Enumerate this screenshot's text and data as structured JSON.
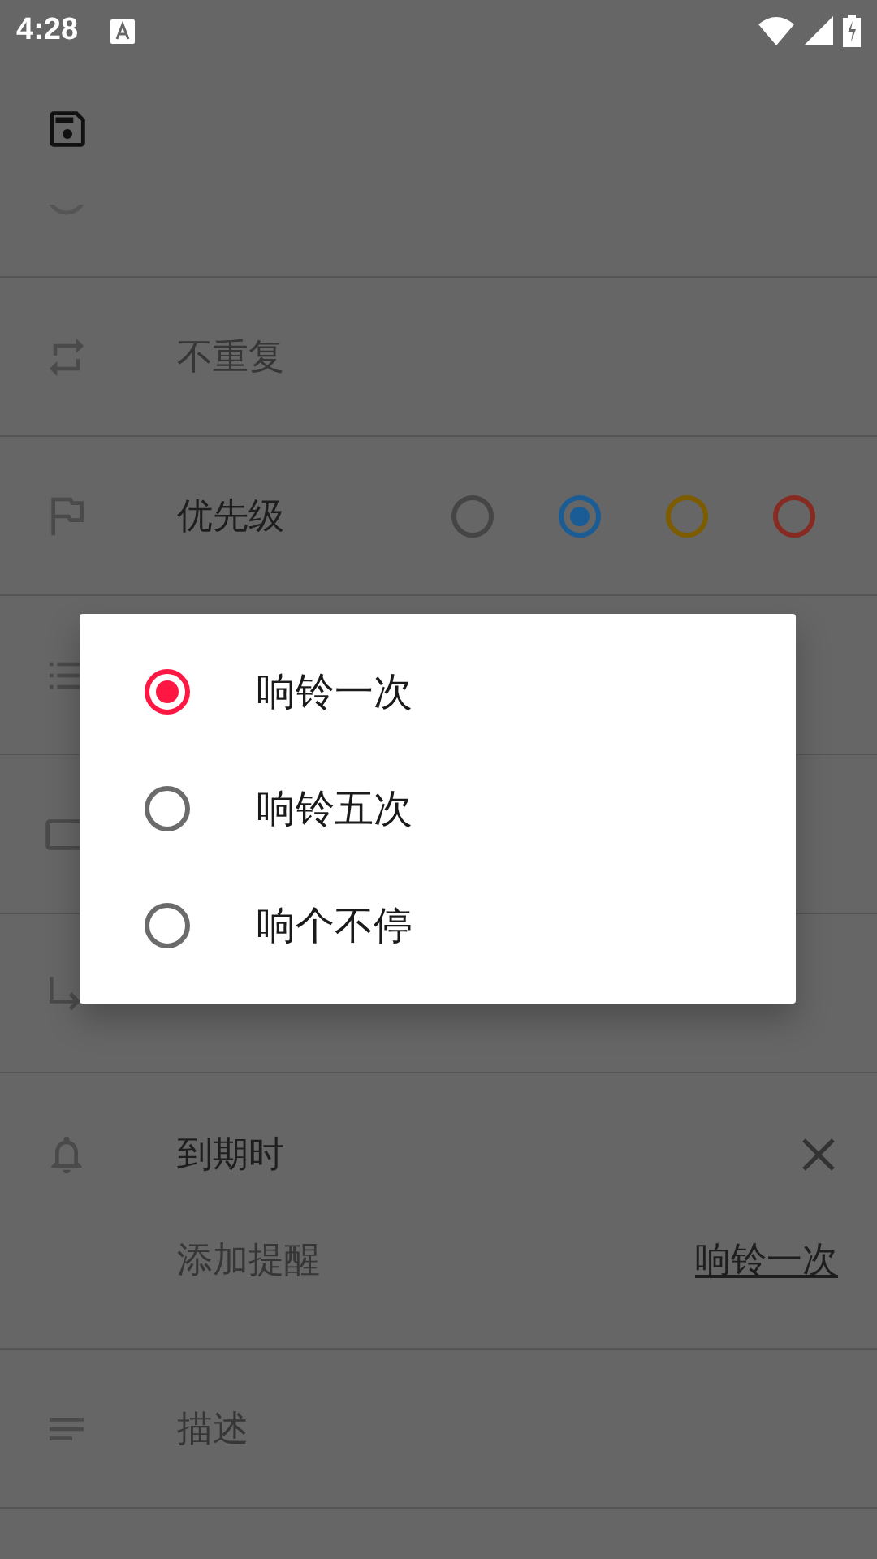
{
  "status_bar": {
    "time": "4:28"
  },
  "rows": [
    {
      "kind": "partial"
    },
    {
      "kind": "repeat",
      "text": "不重复"
    },
    {
      "kind": "priority",
      "label": "优先级",
      "options": [
        {
          "color": "#454545",
          "selected": false
        },
        {
          "color": "#1a5c96",
          "selected": true
        },
        {
          "color": "#7d5c00",
          "selected": false
        },
        {
          "color": "#862a22",
          "selected": false
        }
      ]
    },
    {
      "kind": "list"
    },
    {
      "kind": "box"
    },
    {
      "kind": "subtask"
    },
    {
      "kind": "alarm",
      "title": "到期时",
      "add": "添加提醒",
      "mode": "响铃一次"
    },
    {
      "kind": "description",
      "text": "描述"
    }
  ],
  "dialog": {
    "options": [
      {
        "label": "响铃一次",
        "selected": true
      },
      {
        "label": "响铃五次",
        "selected": false
      },
      {
        "label": "响个不停",
        "selected": false
      }
    ]
  }
}
